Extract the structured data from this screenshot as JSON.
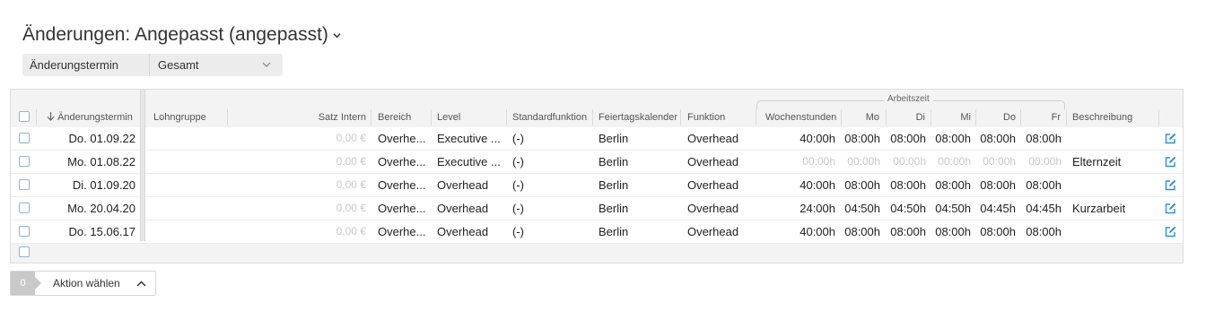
{
  "title": "Änderungen: Angepasst (angepasst)",
  "filter": {
    "label": "Änderungstermin",
    "value": "Gesamt"
  },
  "group_label": "Arbeitszeit",
  "columns": {
    "termin": "Änderungstermin",
    "lohngruppe": "Lohngruppe",
    "satz": "Satz Intern",
    "bereich": "Bereich",
    "level": "Level",
    "standardfunktion": "Standardfunktion",
    "feiertagskalender": "Feiertagskalender",
    "funktion": "Funktion",
    "wochenstunden": "Wochenstunden",
    "mo": "Mo",
    "di": "Di",
    "mi": "Mi",
    "do": "Do",
    "fr": "Fr",
    "beschreibung": "Beschreibung"
  },
  "rows": [
    {
      "termin": "Do. 01.09.22",
      "lohngruppe": "",
      "satz": "0,00 €",
      "bereich": "Overhe...",
      "level": "Executive ...",
      "standardfunktion": "(-)",
      "feiertagskalender": "Berlin",
      "funktion": "Overhead",
      "wochenstunden": "40:00h",
      "mo": "08:00h",
      "di": "08:00h",
      "mi": "08:00h",
      "do": "08:00h",
      "fr": "08:00h",
      "beschreibung": "",
      "muted_hours": false
    },
    {
      "termin": "Mo. 01.08.22",
      "lohngruppe": "",
      "satz": "0,00 €",
      "bereich": "Overhe...",
      "level": "Executive ...",
      "standardfunktion": "(-)",
      "feiertagskalender": "Berlin",
      "funktion": "Overhead",
      "wochenstunden": "00:00h",
      "mo": "00:00h",
      "di": "00:00h",
      "mi": "00:00h",
      "do": "00:00h",
      "fr": "00:00h",
      "beschreibung": "Elternzeit",
      "muted_hours": true
    },
    {
      "termin": "Di. 01.09.20",
      "lohngruppe": "",
      "satz": "0,00 €",
      "bereich": "Overhe...",
      "level": "Overhead",
      "standardfunktion": "(-)",
      "feiertagskalender": "Berlin",
      "funktion": "Overhead",
      "wochenstunden": "40:00h",
      "mo": "08:00h",
      "di": "08:00h",
      "mi": "08:00h",
      "do": "08:00h",
      "fr": "08:00h",
      "beschreibung": "",
      "muted_hours": false
    },
    {
      "termin": "Mo. 20.04.20",
      "lohngruppe": "",
      "satz": "0,00 €",
      "bereich": "Overhe...",
      "level": "Overhead",
      "standardfunktion": "(-)",
      "feiertagskalender": "Berlin",
      "funktion": "Overhead",
      "wochenstunden": "24:00h",
      "mo": "04:50h",
      "di": "04:50h",
      "mi": "04:50h",
      "do": "04:45h",
      "fr": "04:45h",
      "beschreibung": "Kurzarbeit",
      "muted_hours": false
    },
    {
      "termin": "Do. 15.06.17",
      "lohngruppe": "",
      "satz": "0,00 €",
      "bereich": "Overhe...",
      "level": "Overhead",
      "standardfunktion": "(-)",
      "feiertagskalender": "Berlin",
      "funktion": "Overhead",
      "wochenstunden": "40:00h",
      "mo": "08:00h",
      "di": "08:00h",
      "mi": "08:00h",
      "do": "08:00h",
      "fr": "08:00h",
      "beschreibung": "",
      "muted_hours": false
    }
  ],
  "action": {
    "count": "0",
    "label": "Aktion wählen"
  },
  "icons": {
    "sort": "arrow-down-icon",
    "edit": "edit-icon",
    "title_chevron": "chevron-down-icon",
    "action_chevron": "chevron-up-icon"
  },
  "colors": {
    "checkbox_border": "#8ab4d8",
    "edit_icon": "#2f8fd6",
    "muted_text": "#c8c8c8"
  }
}
